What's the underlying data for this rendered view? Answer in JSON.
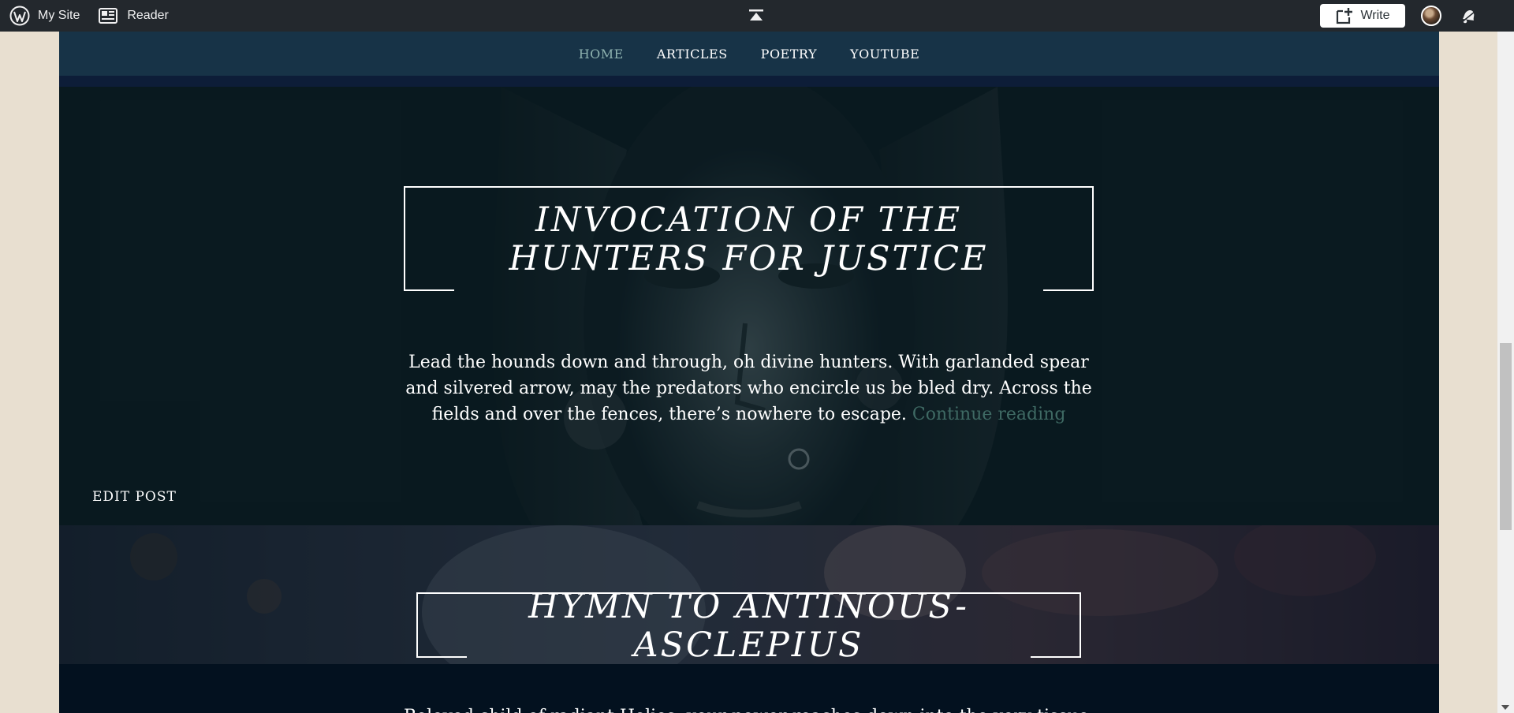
{
  "admin_bar": {
    "my_site_label": "My Site",
    "reader_label": "Reader",
    "write_label": "Write",
    "icons": [
      "wordpress-icon",
      "reader-icon",
      "collapse-icon",
      "write-icon",
      "avatar",
      "notifications-bell-icon"
    ]
  },
  "nav": {
    "items": [
      {
        "label": "HOME",
        "active": true
      },
      {
        "label": "ARTICLES",
        "active": false
      },
      {
        "label": "POETRY",
        "active": false
      },
      {
        "label": "YOUTUBE",
        "active": false
      }
    ]
  },
  "posts": [
    {
      "title": "INVOCATION OF THE HUNTERS FOR JUSTICE",
      "excerpt": "Lead the hounds down and through, oh divine hunters. With garlanded spear and silvered arrow, may the predators who encircle us be bled dry. Across the fields and over the fences, there’s nowhere to escape.",
      "continue_label": "Continue reading",
      "edit_label": "EDIT POST"
    },
    {
      "title": "HYMN TO ANTINOUS-ASCLEPIUS",
      "excerpt": "Beloved child of radiant Helios, your power reaches down into the very tissue of"
    }
  ],
  "colors": {
    "admin_bar_bg": "#23282d",
    "nav_bg": "#173347",
    "nav_active": "#8fb3b0",
    "page_bg": "#03111f",
    "continue_link": "#3f6a64",
    "body_bg": "#e8dfd0"
  }
}
